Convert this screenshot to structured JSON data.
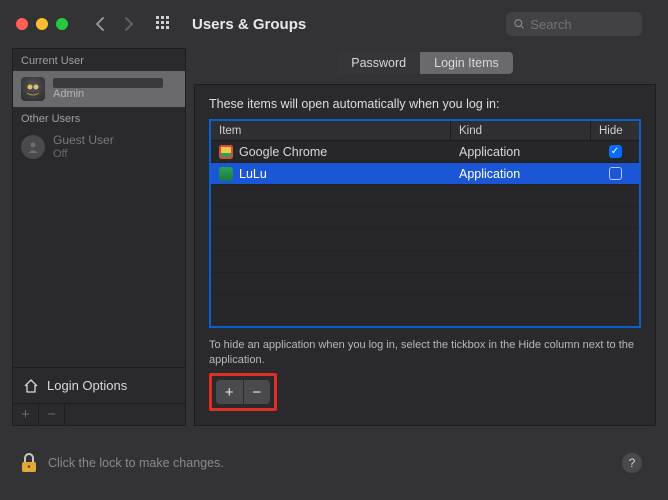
{
  "titlebar": {
    "title": "Users & Groups",
    "search_placeholder": "Search"
  },
  "sidebar": {
    "current_header": "Current User",
    "other_header": "Other Users",
    "current_user": {
      "name_redacted": true,
      "role": "Admin"
    },
    "other_users": [
      {
        "name": "Guest User",
        "status": "Off"
      }
    ],
    "login_options": "Login Options"
  },
  "tabs": {
    "password": "Password",
    "login_items": "Login Items",
    "active": "login_items"
  },
  "panel": {
    "lede": "These items will open automatically when you log in:",
    "columns": {
      "item": "Item",
      "kind": "Kind",
      "hide": "Hide"
    },
    "rows": [
      {
        "name": "Google Chrome",
        "kind": "Application",
        "hide": true,
        "selected": false,
        "icon_color": "#f4c94a"
      },
      {
        "name": "LuLu",
        "kind": "Application",
        "hide": false,
        "selected": true,
        "icon_color": "#2aa35a"
      }
    ],
    "hint": "To hide an application when you log in, select the tickbox in the Hide column next to the application."
  },
  "footer": {
    "text": "Click the lock to make changes."
  }
}
